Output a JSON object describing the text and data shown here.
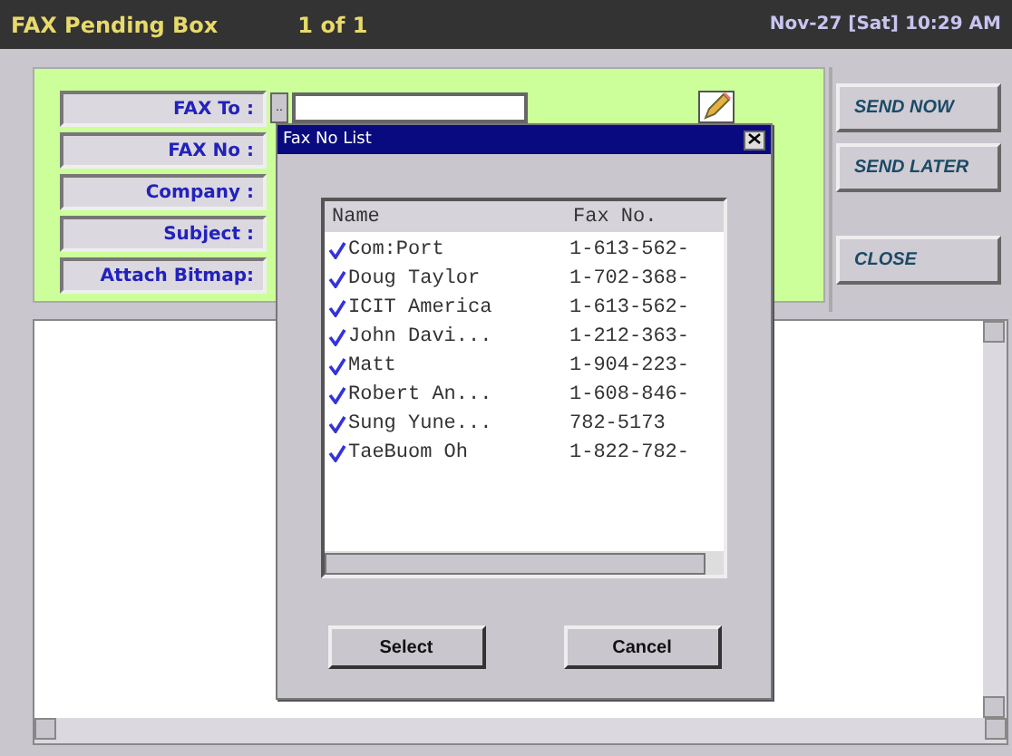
{
  "header": {
    "title": "FAX Pending Box",
    "page": "1 of 1",
    "datetime": "Nov-27 [Sat] 10:29 AM"
  },
  "form": {
    "fields": [
      {
        "label": "FAX To :"
      },
      {
        "label": "FAX No :"
      },
      {
        "label": "Company :"
      },
      {
        "label": "Subject :"
      },
      {
        "label": "Attach Bitmap:"
      }
    ],
    "browse_button": ".."
  },
  "actions": [
    {
      "label": "SEND NOW"
    },
    {
      "label": "SEND LATER"
    },
    {
      "label": "CLOSE"
    }
  ],
  "dialog": {
    "title": "Fax No List",
    "columns": [
      "Name",
      "Fax No."
    ],
    "rows": [
      {
        "name": "Com:Port",
        "fax": "1-613-562-",
        "checked": true
      },
      {
        "name": "Doug Taylor",
        "fax": "1-702-368-",
        "checked": true
      },
      {
        "name": "ICIT America",
        "fax": "1-613-562-",
        "checked": true
      },
      {
        "name": "John Davi...",
        "fax": "1-212-363-",
        "checked": true
      },
      {
        "name": "Matt",
        "fax": "1-904-223-",
        "checked": true
      },
      {
        "name": "Robert An...",
        "fax": "1-608-846-",
        "checked": true
      },
      {
        "name": "Sung Yune...",
        "fax": "782-5173",
        "checked": true
      },
      {
        "name": "TaeBuom Oh",
        "fax": "1-822-782-",
        "checked": true
      }
    ],
    "buttons": [
      "Select",
      "Cancel"
    ]
  }
}
